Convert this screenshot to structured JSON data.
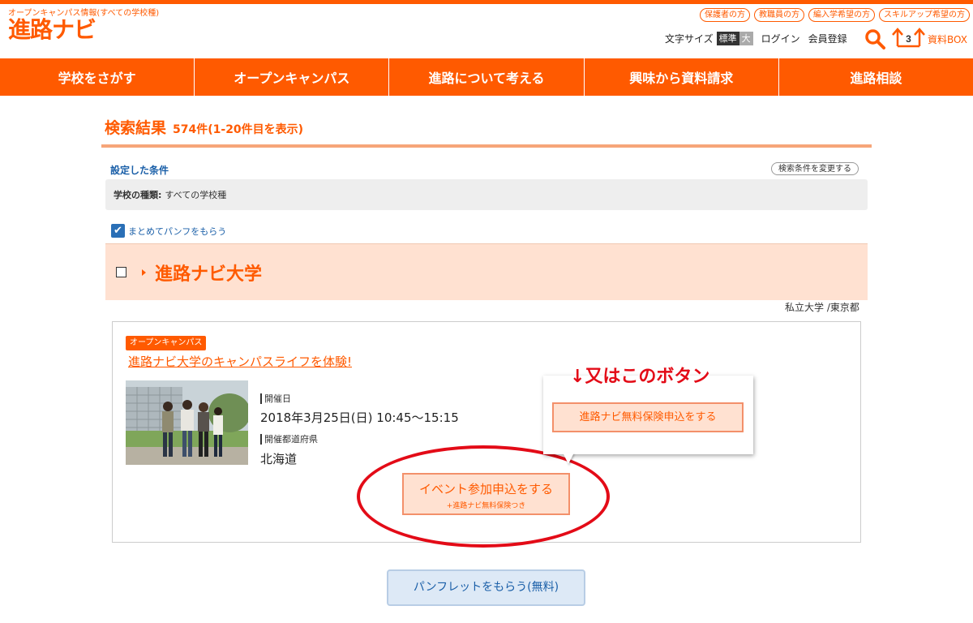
{
  "header": {
    "tagline": "オープンキャンパス情報(すべての学校種)",
    "logo": "進路ナビ",
    "audience_links": [
      "保護者の方",
      "教職員の方",
      "編入学希望の方",
      "スキルアップ希望の方"
    ],
    "font_size_label": "文字サイズ",
    "font_size_standard": "標準",
    "font_size_large": "大",
    "login": "ログイン",
    "register": "会員登録",
    "box_count": "3",
    "box_label": "資料BOX"
  },
  "nav": {
    "items": [
      "学校をさがす",
      "オープンキャンパス",
      "進路について考える",
      "興味から資料請求",
      "進路相談"
    ]
  },
  "results": {
    "title": "検索結果",
    "count": "574件(1-20件目を表示)"
  },
  "conditions": {
    "label": "設定した条件",
    "change_button": "検索条件を変更する",
    "key": "学校の種類:",
    "value": "すべての学校種"
  },
  "bulk_pamphlet": {
    "label": "まとめてパンフをもらう",
    "checked": true
  },
  "school": {
    "name": "進路ナビ大学",
    "meta": "私立大学 /東京都"
  },
  "event": {
    "badge": "オープンキャンパス",
    "title": "進路ナビ大学のキャンパスライフを体験!",
    "date_label": "開催日",
    "date_value": "2018年3月25日(日) 10:45〜15:15",
    "pref_label": "開催都道府県",
    "pref_value": "北海道",
    "apply_main": "イベント参加申込をする",
    "apply_sub": "+進路ナビ無料保険つき"
  },
  "callout": {
    "title": "↓又はこのボタン",
    "button": "進路ナビ無料保険申込をする"
  },
  "pamphlet_button": "パンフレットをもらう(無料)",
  "colors": {
    "brand_orange": "#ff5a00",
    "annotation_red": "#e30b17",
    "link_blue": "#1a5fa8",
    "band_peach": "#ffe1d1"
  },
  "icons": [
    "search-icon",
    "box-icon"
  ]
}
